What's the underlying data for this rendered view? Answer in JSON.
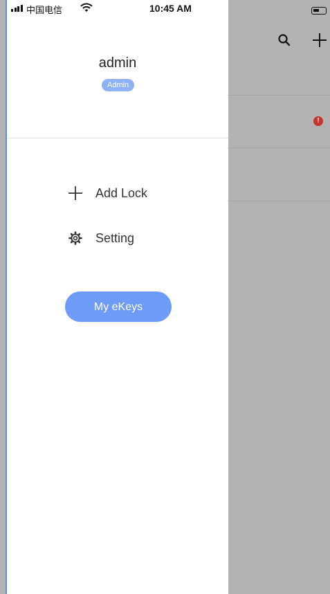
{
  "status_bar": {
    "carrier": "中国电信",
    "time": "10:45 AM"
  },
  "profile": {
    "name": "admin",
    "role_badge": "Admin"
  },
  "menu": {
    "items": [
      {
        "label": "Add Lock",
        "icon": "plus-icon"
      },
      {
        "label": "Setting",
        "icon": "gear-icon"
      }
    ]
  },
  "ekeys_button": {
    "label": "My eKeys"
  },
  "background_screen": {
    "icons": [
      "search-icon",
      "plus-icon",
      "alert-icon",
      "battery-icon"
    ]
  },
  "colors": {
    "accent": "#6f9bf8",
    "badge": "#8fb1f6",
    "dim_overlay": "#b3b3b3",
    "alert": "#c8312e",
    "drawer_border": "#5b8fd6"
  }
}
